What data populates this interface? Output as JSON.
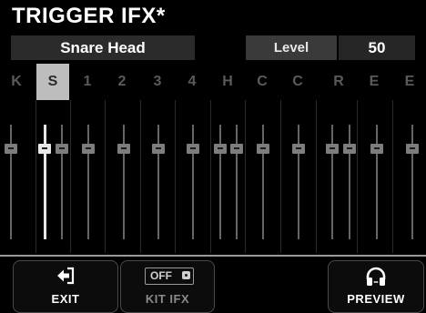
{
  "title": "TRIGGER IFX*",
  "header": {
    "instrument_name": "Snare Head",
    "param_label": "Level",
    "param_value": "50"
  },
  "channels": [
    "K",
    "S",
    "1",
    "2",
    "3",
    "4",
    "H",
    "C",
    "C",
    "R",
    "E",
    "E"
  ],
  "selected_channel_index": 1,
  "buttons": {
    "exit": "EXIT",
    "kit_ifx": "KIT IFX",
    "kit_ifx_state": "OFF",
    "preview": "PREVIEW"
  },
  "colors": {
    "background": "#000000",
    "header_bg": "#2b2b2b",
    "selected_channel": "#bdbdbd",
    "inactive_text": "#5a5a5a"
  },
  "icons": {
    "exit": "exit-arrow-icon",
    "kit_ifx": "toggle-switch-icon",
    "preview": "headphones-icon"
  }
}
